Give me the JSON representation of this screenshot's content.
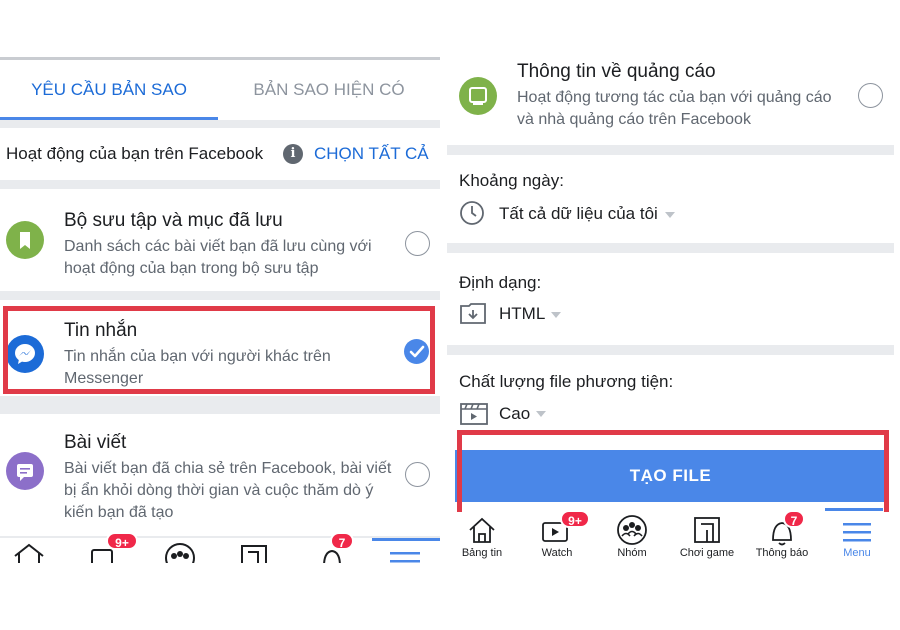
{
  "left": {
    "tabs": [
      {
        "label": "YÊU CẦU BẢN SAO",
        "active": true
      },
      {
        "label": "BẢN SAO HIỆN CÓ",
        "active": false
      }
    ],
    "activity_header": "Hoạt động của bạn trên Facebook",
    "select_all": "CHỌN TẤT CẢ",
    "items": [
      {
        "title": "Bộ sưu tập và mục đã lưu",
        "desc": "Danh sách các bài viết bạn đã lưu cùng với hoạt động của bạn trong bộ sưu tập",
        "icon": "bookmark-icon",
        "color": "#7fb24a",
        "checked": false
      },
      {
        "title": "Tin nhắn",
        "desc": "Tin nhắn của bạn với người khác trên Messenger",
        "icon": "messenger-icon",
        "color": "#1c6bd7",
        "checked": true
      },
      {
        "title": "Bài viết",
        "desc": "Bài viết bạn đã chia sẻ trên Facebook, bài viết bị ẩn khỏi dòng thời gian và cuộc thăm dò ý kiến bạn đã tạo",
        "icon": "post-icon",
        "color": "#8c6fc9",
        "checked": false
      }
    ],
    "nav_badges": {
      "watch": "9+",
      "notifications": "7"
    }
  },
  "right": {
    "ads_item": {
      "title": "Thông tin về quảng cáo",
      "desc": "Hoạt động tương tác của bạn với quảng cáo và nhà quảng cáo trên Facebook",
      "icon": "ad-icon",
      "color": "#7fb24a",
      "checked": false
    },
    "date_range": {
      "label": "Khoảng ngày:",
      "value": "Tất cả dữ liệu của tôi",
      "icon": "clock-icon"
    },
    "format": {
      "label": "Định dạng:",
      "value": "HTML",
      "icon": "download-folder-icon"
    },
    "media_quality": {
      "label": "Chất lượng file phương tiện:",
      "value": "Cao",
      "icon": "film-icon"
    },
    "create_button": "TẠO FILE",
    "nav": [
      {
        "label": "Bảng tin",
        "icon": "home-icon",
        "badge": ""
      },
      {
        "label": "Watch",
        "icon": "watch-icon",
        "badge": "9+"
      },
      {
        "label": "Nhóm",
        "icon": "groups-icon",
        "badge": ""
      },
      {
        "label": "Chơi game",
        "icon": "gaming-icon",
        "badge": ""
      },
      {
        "label": "Thông báo",
        "icon": "bell-icon",
        "badge": "7"
      },
      {
        "label": "Menu",
        "icon": "menu-icon",
        "badge": ""
      }
    ]
  },
  "colors": {
    "accent": "#4a87e8",
    "link": "#1c6bd7",
    "highlight": "#e03a48",
    "badge": "#f02849"
  }
}
